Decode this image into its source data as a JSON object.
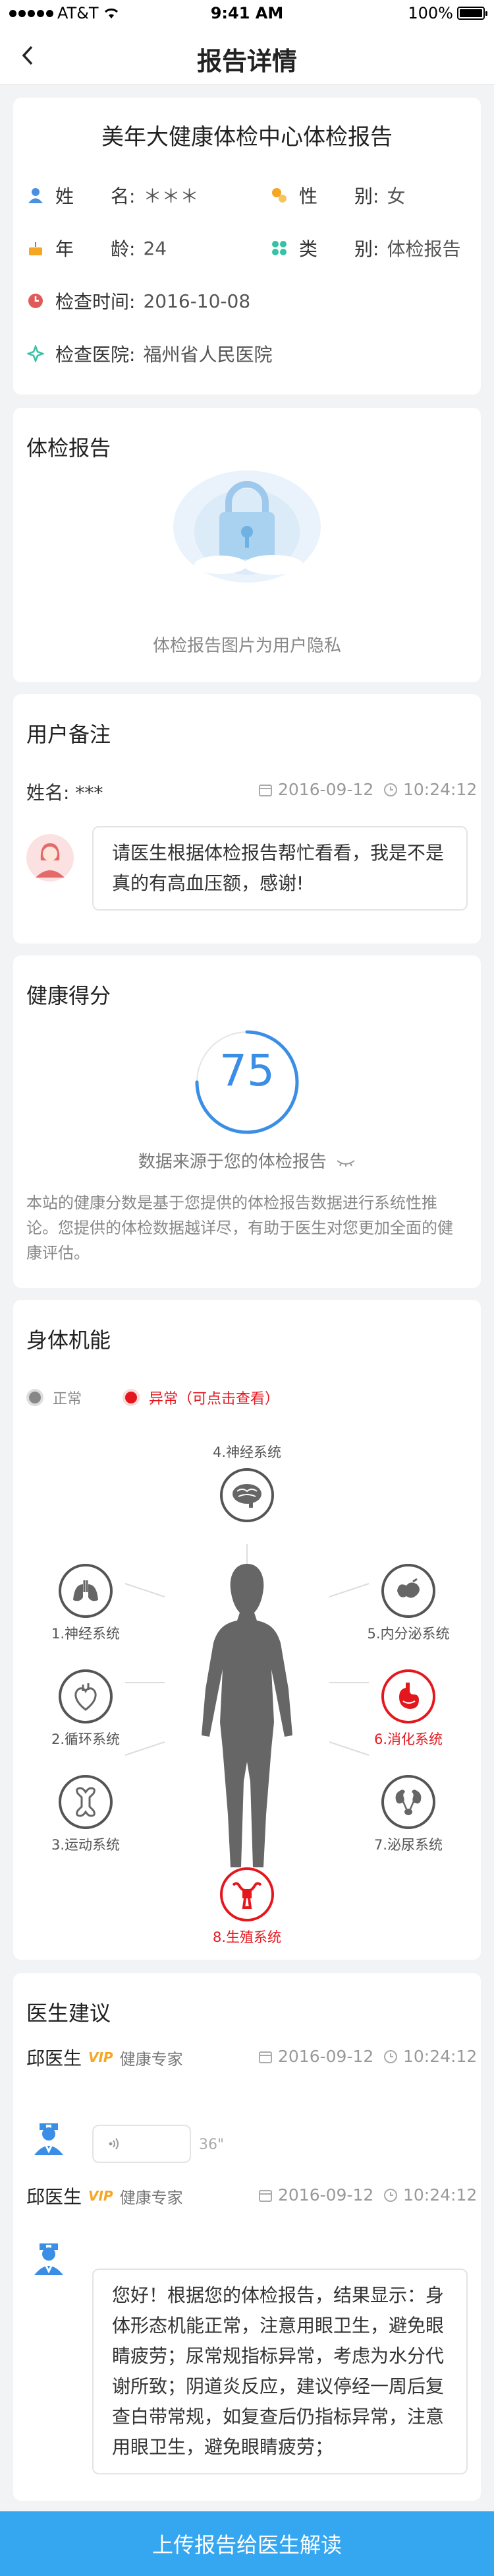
{
  "status_bar": {
    "carrier": "AT&T",
    "time": "9:41 AM",
    "battery": "100%"
  },
  "nav": {
    "title": "报告详情"
  },
  "info": {
    "title": "美年大健康体检中心体检报告",
    "name_label": "姓　　名:",
    "name_value": "＊＊＊",
    "gender_label": "性　　别:",
    "gender_value": "女",
    "age_label": "年　　龄:",
    "age_value": "24",
    "type_label": "类　　别:",
    "type_value": "体检报告",
    "time_label": "检查时间:",
    "time_value": "2016-10-08",
    "hospital_label": "检查医院:",
    "hospital_value": "福州省人民医院",
    "colors": {
      "person": "#4a90e2",
      "gender": "#f5a623",
      "cake": "#f5a623",
      "type": "#35c2a5",
      "clock": "#e05a5a",
      "hospital": "#35c2a5"
    }
  },
  "report": {
    "title": "体检报告",
    "privacy_text": "体检报告图片为用户隐私"
  },
  "remark": {
    "title": "用户备注",
    "name": "姓名: ***",
    "date": "2016-09-12",
    "time": "10:24:12",
    "message": "请医生根据体检报告帮忙看看，我是不是真的有高血压额，感谢!"
  },
  "health": {
    "title": "健康得分",
    "score": "75",
    "score_fraction": 0.75,
    "source": "数据来源于您的体检报告",
    "description": "本站的健康分数是基于您提供的体检报告数据进行系统性推论。您提供的体检数据越详尽，有助于医生对您更加全面的健康评估。"
  },
  "body": {
    "title": "身体机能",
    "legend_normal": "正常",
    "legend_abnormal": "异常（可点击查看）",
    "organs": {
      "neural_top": "4.神经系统",
      "neural_left": "1.神经系统",
      "circulatory": "2.循环系统",
      "motor": "3.运动系统",
      "endocrine": "5.内分泌系统",
      "digestive": "6.消化系统",
      "urinary": "7.泌尿系统",
      "reproductive": "8.生殖系统"
    },
    "colors": {
      "normal": "#888888",
      "abnormal": "#e5171e"
    }
  },
  "advice": {
    "title": "医生建议",
    "doctors": [
      {
        "name": "邱医生",
        "vip": "VIP",
        "tag": "健康专家",
        "date": "2016-09-12",
        "time": "10:24:12",
        "voice_duration": "36\""
      },
      {
        "name": "邱医生",
        "vip": "VIP",
        "tag": "健康专家",
        "date": "2016-09-12",
        "time": "10:24:12",
        "message": "您好！根据您的体检报告，结果显示：身体形态机能正常，注意用眼卫生，避免眼睛疲劳；尿常规指标异常，考虑为水分代谢所致；阴道炎反应，建议停经一周后复查白带常规，如复查后仍指标异常，注意用眼卫生，避免眼睛疲劳；"
      }
    ]
  },
  "bottom_button": "上传报告给医生解读"
}
